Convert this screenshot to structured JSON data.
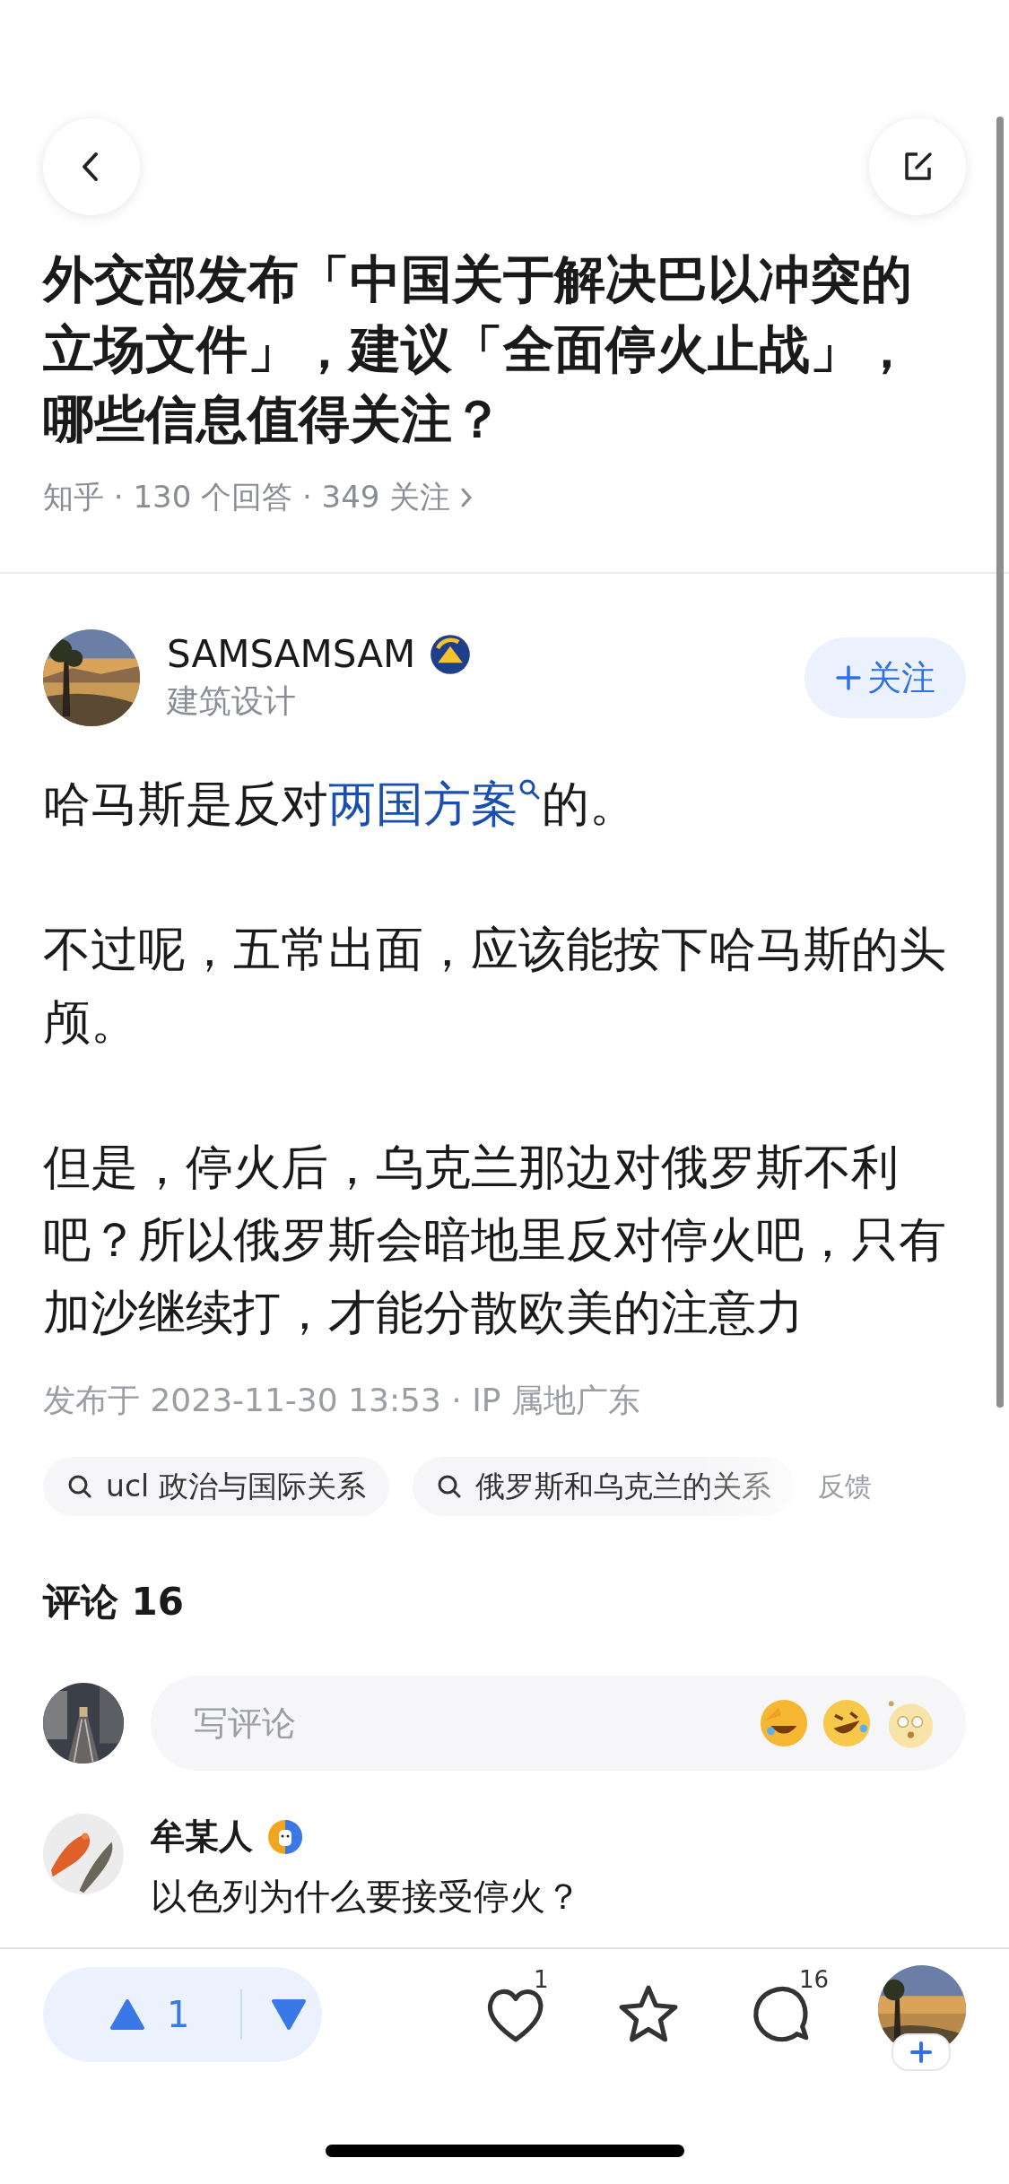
{
  "question": {
    "title": "外交部发布「中国关于解决巴以冲突的立场文件」，建议「全面停火止战」，哪些信息值得关注？",
    "meta": "知乎 · 130 个回答 · 349 关注"
  },
  "answer": {
    "author": "SAMSAMSAM",
    "bio": "建筑设计",
    "follow": "关注",
    "followed": false,
    "paragraphs": [
      [
        {
          "kind": "text",
          "text": "哈马斯是反对"
        },
        {
          "kind": "link",
          "text": "两国方案"
        },
        {
          "kind": "text",
          "text": "的。"
        }
      ],
      [
        {
          "kind": "text",
          "text": "不过呢，五常出面，应该能按下哈马斯的头颅。"
        }
      ],
      [
        {
          "kind": "text",
          "text": "但是，停火后，乌克兰那边对俄罗斯不利吧？所以俄罗斯会暗地里反对停火吧，只有加沙继续打，才能分散欧美的注意力"
        }
      ]
    ],
    "published": "发布于 2023-11-30 13:53 · IP 属地广东"
  },
  "tags": [
    {
      "label": "ucl 政治与国际关系"
    },
    {
      "label": "俄罗斯和乌克兰的关系"
    }
  ],
  "feedback": "反馈",
  "comments": {
    "heading": "评论 16",
    "placeholder": "写评论",
    "items": [
      {
        "name": "牟某人",
        "text": "以色列为什么要接受停火？"
      }
    ]
  },
  "bottom_bar": {
    "upvotes": "1",
    "likes": "1",
    "comments": "16"
  }
}
